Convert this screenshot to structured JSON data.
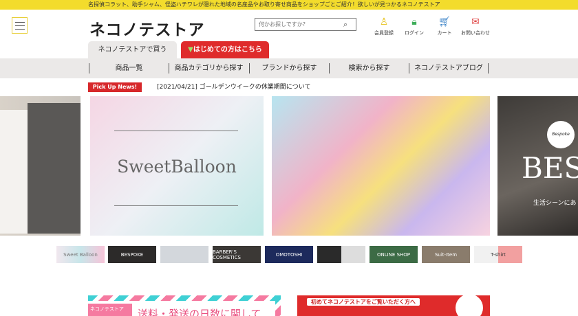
{
  "topbar": {
    "text": "名探偵コラット、助手シャム、怪盗ハチワレが隠れた地域の名産品やお取り寄せ商品をショップごとご紹介！欲しいが見つかるネコノテストア"
  },
  "header": {
    "logo": "ネコノテストア",
    "search_placeholder": "何かお探しですか？",
    "icons": [
      {
        "label": "会員登録",
        "icon": "person-icon",
        "color": "#e6c21a"
      },
      {
        "label": "ログイン",
        "icon": "lock-icon",
        "color": "#3fae5a"
      },
      {
        "label": "カート",
        "icon": "cart-icon",
        "color": "#2e7bc4"
      },
      {
        "label": "お問い合わせ",
        "icon": "mail-icon",
        "color": "#e04848"
      }
    ]
  },
  "tabs": [
    "ネコノテストアで買う",
    "はじめての方はこちら"
  ],
  "nav": [
    "商品一覧",
    "商品カテゴリから探す",
    "ブランドから探す",
    "検索から探す",
    "ネコノテストアブログ"
  ],
  "news": {
    "badge": "Pick Up News!",
    "item": "[2021/04/21]  ゴールデンウイークの休業期間について"
  },
  "carousel": {
    "main_title": "SweetBalloon",
    "right_title": "BES",
    "right_sub": "生活シーンにあ",
    "right_badge": "Bespoke"
  },
  "thumbs": [
    "Sweet Balloon",
    "BESPOKE",
    "",
    "BARBER'S COSMETICS",
    "OMOTOSHI",
    "",
    "ONLINE SHOP",
    "Suit-Item",
    "T-shirt"
  ],
  "banners": {
    "left_tag": "ネコノテストア",
    "left_title": "送料・発送の日数に関して",
    "right_title": "初めてネコノテストアをご覧いただく方へ"
  }
}
